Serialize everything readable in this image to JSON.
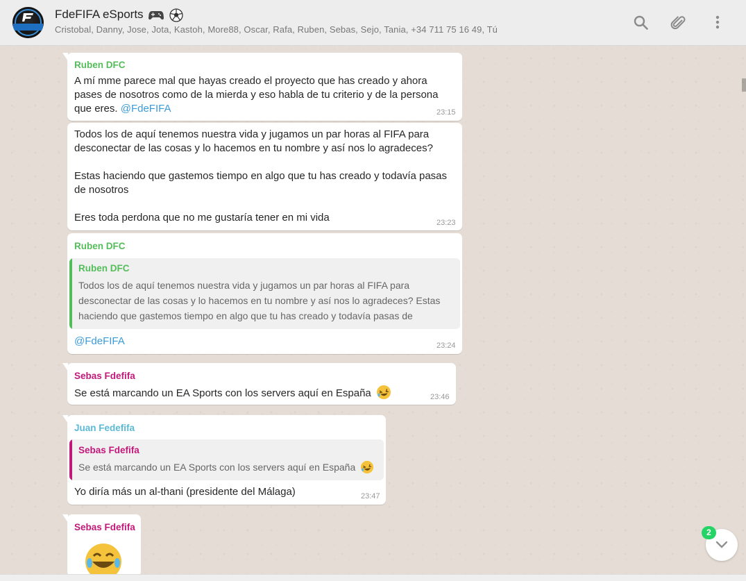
{
  "header": {
    "title": "FdeFIFA eSports",
    "participants": "Cristobal, Danny, Jose, Jota, Kastoh, More88, Oscar, Rafa, Ruben, Sebas, Sejo, Tania, +34 711 75 16 49, Tú",
    "icons": [
      "search-icon",
      "attach-icon",
      "menu-icon"
    ]
  },
  "colors": {
    "ruben": "#53bd5a",
    "sebas": "#c2187a",
    "juan": "#5bbad5",
    "mention": "#3b9bd9",
    "unread": "#25d366"
  },
  "messages": [
    {
      "sender": "Ruben DFC",
      "lines": [
        "A mí mme parece mal que hayas creado el proyecto que has creado y ahora",
        "pases de nosotros como de la mierda y eso habla de tu criterio y de la persona",
        "que eres. "
      ],
      "mention": "@FdeFIFA",
      "time": "23:15"
    },
    {
      "lines": [
        "Todos los de aquí tenemos nuestra vida y jugamos un par horas al FIFA para",
        "desconectar de las cosas y lo hacemos en tu nombre y así nos lo agradeces?",
        "Estas haciendo que gastemos tiempo en algo que tu has creado y todavía pasas",
        "de nosotros",
        "Eres toda perdona que no me gustaría tener en mi vida"
      ],
      "time": "23:23"
    },
    {
      "sender": "Ruben DFC",
      "quote": {
        "sender": "Ruben DFC",
        "lines": [
          "Todos los de aquí tenemos nuestra vida y jugamos un par horas al FIFA para",
          "desconectar de las cosas y lo hacemos en tu nombre y así nos lo agradeces? Estas",
          "haciendo que gastemos tiempo en algo que tu has creado y todavía pasas de"
        ]
      },
      "mention": "@FdeFIFA",
      "time": "23:24"
    },
    {
      "sender": "Sebas Fdefifa",
      "text": "Se está marcando un EA Sports con los servers aquí en España",
      "time": "23:46"
    },
    {
      "sender": "Juan Fedefifa",
      "quote": {
        "sender": "Sebas Fdefifa",
        "text": "Se está marcando un EA Sports con los servers aquí en España"
      },
      "text": "Yo diría más un al-thani (presidente del Málaga)",
      "time": "23:47"
    },
    {
      "sender": "Sebas Fdefifa"
    }
  ],
  "unread_count": "2"
}
